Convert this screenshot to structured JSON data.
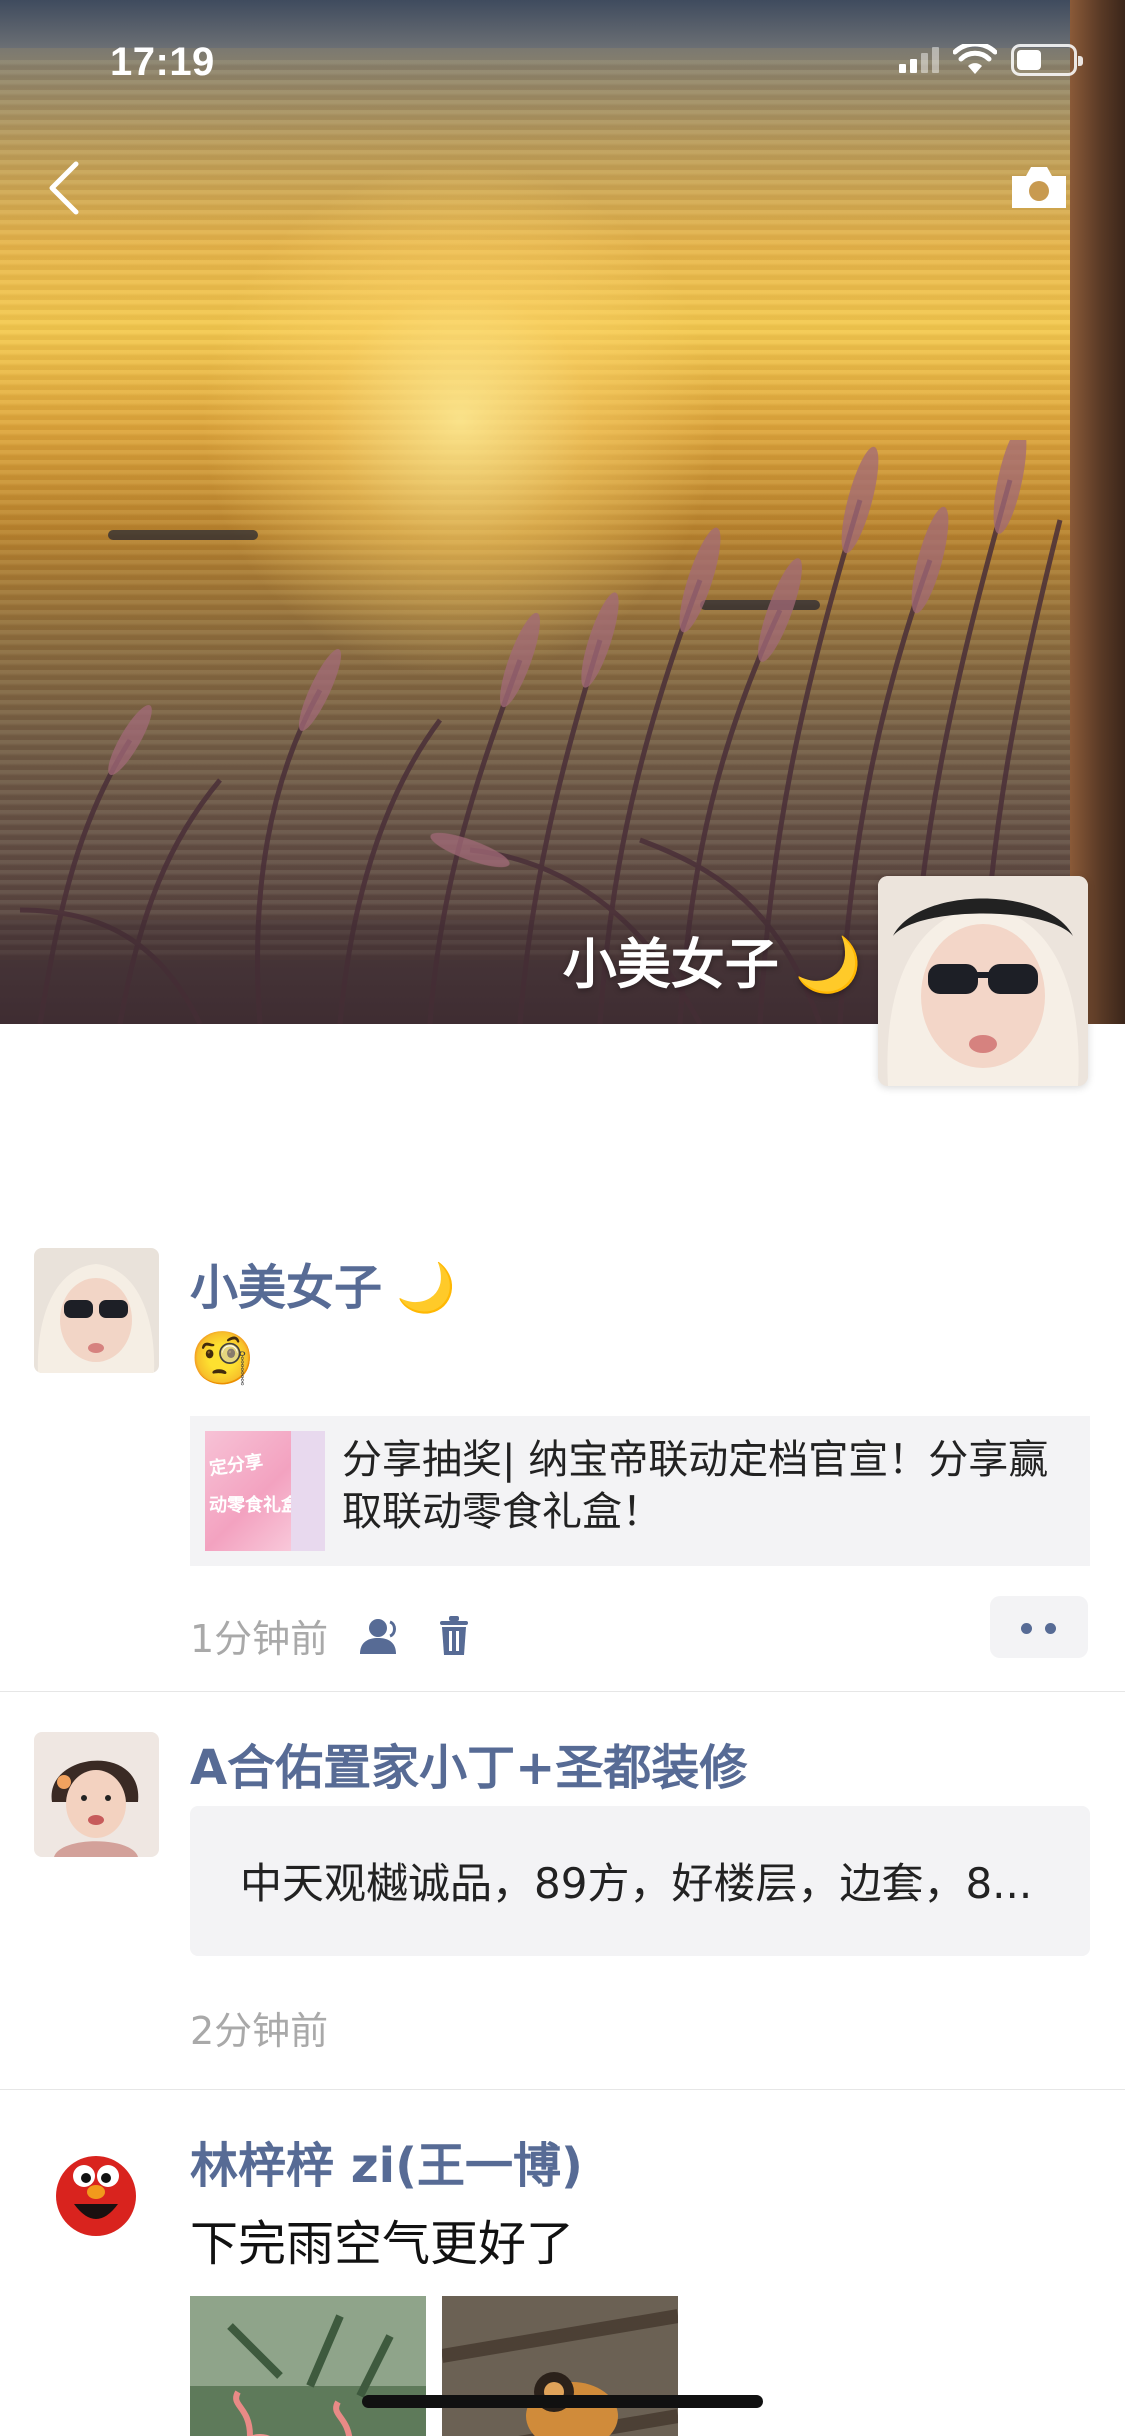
{
  "status_bar": {
    "time": "17:19"
  },
  "cover": {
    "user_name": "小美女子",
    "name_emoji": "🌙"
  },
  "posts": [
    {
      "author": "小美女子",
      "author_emoji": "🌙",
      "text": "🧐",
      "link_card": {
        "thumb_text_1": "定分享",
        "thumb_text_2": "动零食礼盒",
        "title": "分享抽奖| 纳宝帝联动定档官宣！分享赢取联动零食礼盒！"
      },
      "time": "1分钟前"
    },
    {
      "author": "A合佑置家小丁+圣都装修",
      "snippet": "中天观樾诚品，89方，好楼层，边套，8...",
      "time": "2分钟前"
    },
    {
      "author": "林梓梓 zi(王一博)",
      "text": "下完雨空气更好了"
    }
  ]
}
